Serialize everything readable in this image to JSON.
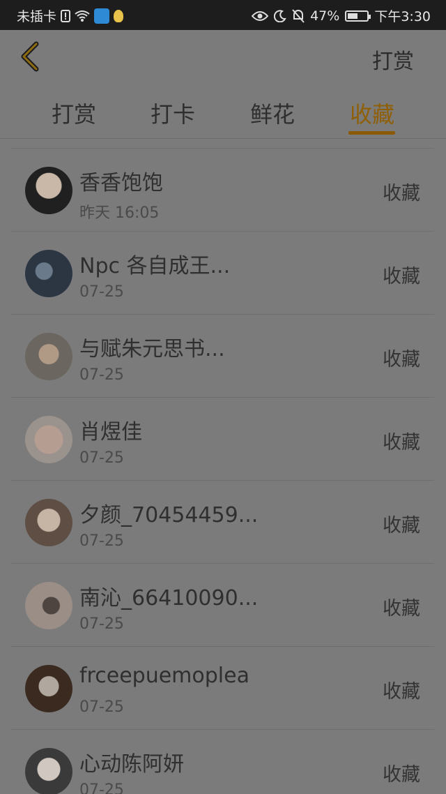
{
  "status": {
    "carrier": "未插卡",
    "battery": "47%",
    "time": "下午3:30"
  },
  "header": {
    "action_label": "打赏"
  },
  "tabs": [
    {
      "label": "打赏"
    },
    {
      "label": "打卡"
    },
    {
      "label": "鲜花"
    },
    {
      "label": "收藏"
    }
  ],
  "active_tab": "收藏",
  "list": [
    {
      "name": "香香饱饱",
      "time": "昨天 16:05",
      "action": "收藏",
      "avatar_color": "#2a2a2a"
    },
    {
      "name": "Npc 各自成王...",
      "time": "07-25",
      "action": "收藏",
      "avatar_color": "#3a4a5a"
    },
    {
      "name": "与赋朱元思书...",
      "time": "07-25",
      "action": "收藏",
      "avatar_color": "#8a7a6e"
    },
    {
      "name": "肖煜佳",
      "time": "07-25",
      "action": "收藏",
      "avatar_color": "#9a8e86"
    },
    {
      "name": "夕颜_70454459...",
      "time": "07-25",
      "action": "收藏",
      "avatar_color": "#6a5a4e"
    },
    {
      "name": "南沁_66410090...",
      "time": "07-25",
      "action": "收藏",
      "avatar_color": "#8b7f78"
    },
    {
      "name": "frceepuemoplea",
      "time": "07-25",
      "action": "收藏",
      "avatar_color": "#3a2a20"
    },
    {
      "name": "心动陈阿妍",
      "time": "07-25",
      "action": "收藏",
      "avatar_color": "#6e6e6e"
    }
  ]
}
